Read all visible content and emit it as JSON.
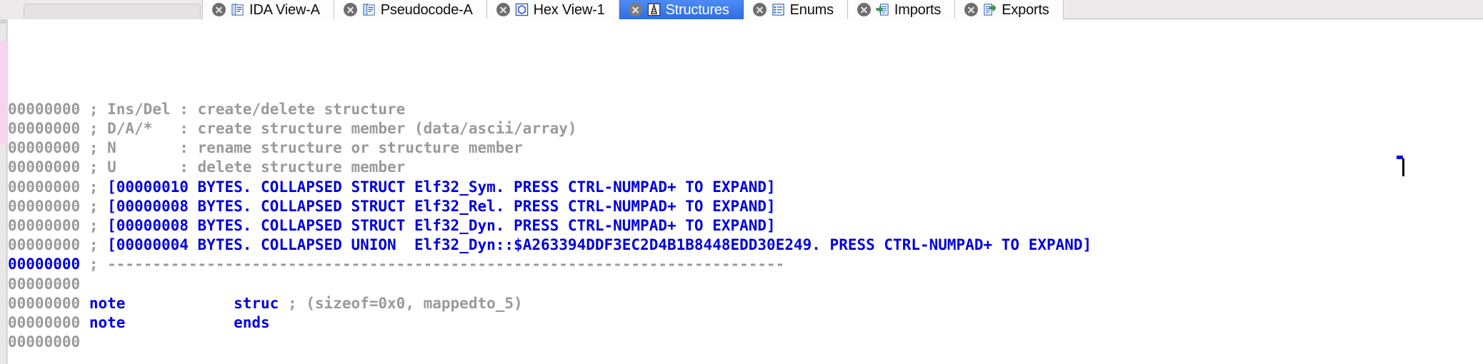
{
  "window": {
    "app": "IDA",
    "accent_active_tab": "#2f6de0",
    "comment_color": "#9a9a9a",
    "keyword_color": "#0000dd"
  },
  "tabs": [
    {
      "label": "IDA View-A",
      "icon": "document-lines-icon",
      "active": false,
      "closable": true
    },
    {
      "label": "Pseudocode-A",
      "icon": "document-lines-icon",
      "active": false,
      "closable": true
    },
    {
      "label": "Hex View-1",
      "icon": "hexagon-icon",
      "active": false,
      "closable": true
    },
    {
      "label": "Structures",
      "icon": "structures-icon",
      "active": true,
      "closable": true
    },
    {
      "label": "Enums",
      "icon": "enum-list-icon",
      "active": false,
      "closable": true
    },
    {
      "label": "Imports",
      "icon": "import-arrow-icon",
      "active": false,
      "closable": true
    },
    {
      "label": "Exports",
      "icon": "export-arrow-icon",
      "active": false,
      "closable": true
    }
  ],
  "editor": {
    "address_blank": "00000000",
    "caret_visible": true,
    "lines": [
      {
        "addr": "00000000",
        "current": false,
        "parts": [
          {
            "t": "; Ins/Del : create/delete structure",
            "c": "cmt"
          }
        ]
      },
      {
        "addr": "00000000",
        "current": false,
        "parts": [
          {
            "t": "; D/A/*   : create structure member (data/ascii/array)",
            "c": "cmt"
          }
        ]
      },
      {
        "addr": "00000000",
        "current": false,
        "parts": [
          {
            "t": "; N       : rename structure or structure member",
            "c": "cmt"
          }
        ]
      },
      {
        "addr": "00000000",
        "current": false,
        "parts": [
          {
            "t": "; U       : delete structure member",
            "c": "cmt"
          }
        ]
      },
      {
        "addr": "00000000",
        "current": false,
        "parts": [
          {
            "t": "; ",
            "c": "cmt"
          },
          {
            "t": "[00000010 BYTES. COLLAPSED STRUCT Elf32_Sym. PRESS CTRL-NUMPAD+ TO EXPAND]",
            "c": "blue"
          }
        ]
      },
      {
        "addr": "00000000",
        "current": false,
        "parts": [
          {
            "t": "; ",
            "c": "cmt"
          },
          {
            "t": "[00000008 BYTES. COLLAPSED STRUCT Elf32_Rel. PRESS CTRL-NUMPAD+ TO EXPAND]",
            "c": "blue"
          }
        ]
      },
      {
        "addr": "00000000",
        "current": false,
        "parts": [
          {
            "t": "; ",
            "c": "cmt"
          },
          {
            "t": "[00000008 BYTES. COLLAPSED STRUCT Elf32_Dyn. PRESS CTRL-NUMPAD+ TO EXPAND]",
            "c": "blue"
          }
        ]
      },
      {
        "addr": "00000000",
        "current": false,
        "parts": [
          {
            "t": "; ",
            "c": "cmt"
          },
          {
            "t": "[00000004 BYTES. COLLAPSED UNION  Elf32_Dyn::$A263394DDF3EC2D4B1B8448EDD30E249. PRESS CTRL-NUMPAD+ TO EXPAND]",
            "c": "blue"
          }
        ]
      },
      {
        "addr": "00000000",
        "current": true,
        "parts": [
          {
            "t": "; ---------------------------------------------------------------------------",
            "c": "cmt"
          }
        ]
      },
      {
        "addr": "00000000",
        "current": false,
        "parts": [
          {
            "t": "",
            "c": "cmt"
          }
        ]
      },
      {
        "addr": "00000000",
        "current": false,
        "parts": [
          {
            "t": "note            ",
            "c": "kw"
          },
          {
            "t": "struc ",
            "c": "kw"
          },
          {
            "t": "; (sizeof=0x0, mappedto_5)",
            "c": "cmt"
          }
        ]
      },
      {
        "addr": "00000000",
        "current": false,
        "parts": [
          {
            "t": "note            ",
            "c": "kw"
          },
          {
            "t": "ends",
            "c": "kw"
          }
        ]
      },
      {
        "addr": "00000000",
        "current": false,
        "parts": [
          {
            "t": "",
            "c": "cmt"
          }
        ]
      }
    ]
  }
}
